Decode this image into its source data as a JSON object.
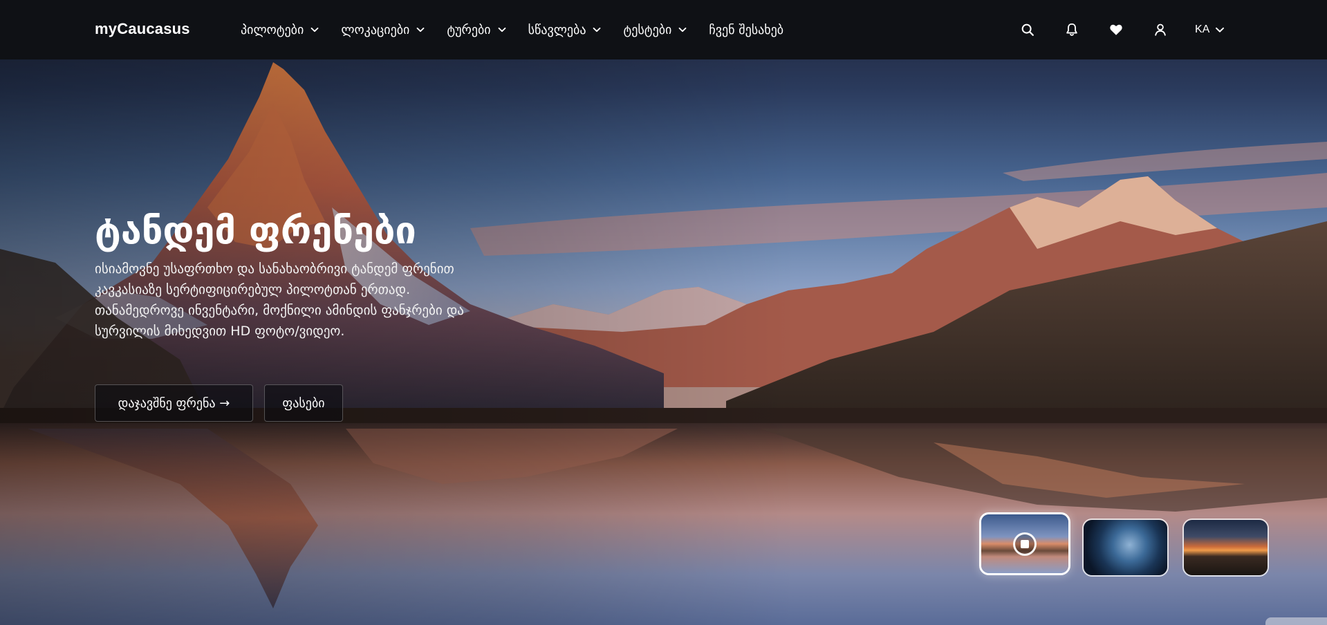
{
  "brand": "myCaucasus",
  "nav": {
    "items": [
      {
        "label": "პილოტები",
        "has_dropdown": true
      },
      {
        "label": "ლოკაციები",
        "has_dropdown": true
      },
      {
        "label": "ტურები",
        "has_dropdown": true
      },
      {
        "label": "სწავლება",
        "has_dropdown": true
      },
      {
        "label": "ტესტები",
        "has_dropdown": true
      },
      {
        "label": "ჩვენ შესახებ",
        "has_dropdown": false
      }
    ],
    "icons": [
      "search-icon",
      "bell-icon",
      "heart-icon",
      "user-icon"
    ],
    "language": "KA"
  },
  "hero": {
    "title": "ტანდემ ფრენები",
    "description": "ისიამოვნე უსაფრთხო და სანახაობრივი ტანდემ ფრენით კავკასიაზე სერტიფიცირებულ პილოტთან ერთად. თანამედროვე ინვენტარი, მოქნილი ამინდის ფანჯრები და სურვილის მიხედვით HD ფოტო/ვიდეო.",
    "primary_button": "დაჯავშნე ფრენა →",
    "secondary_button": "ფასები"
  },
  "thumbnails": [
    {
      "name": "mountain-lake-sunset",
      "active": true,
      "state_icon": "stop-icon"
    },
    {
      "name": "earth-space",
      "active": false
    },
    {
      "name": "sunset-lake",
      "active": false
    }
  ],
  "colors": {
    "navbar_bg": "#0f1115",
    "text": "#ffffff",
    "button_bg": "rgba(12,12,16,0.62)"
  }
}
